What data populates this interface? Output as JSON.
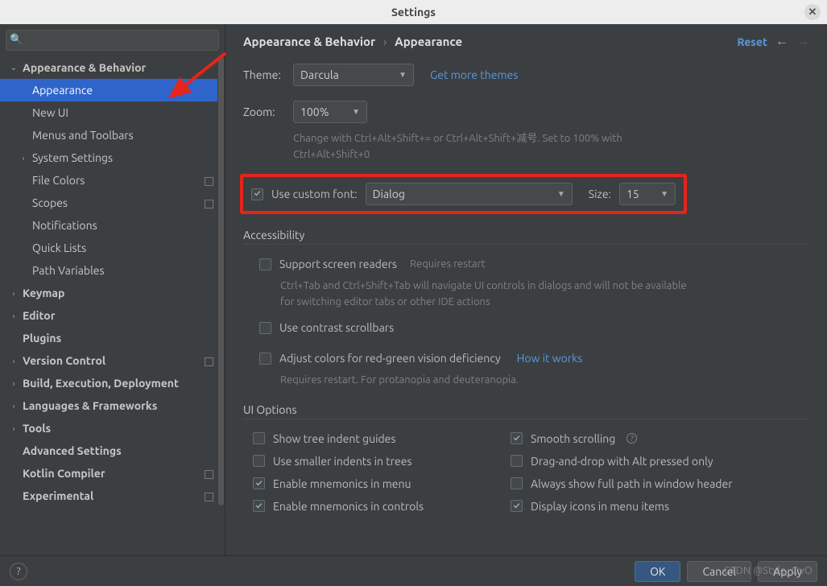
{
  "title": "Settings",
  "search": {
    "placeholder": ""
  },
  "sidebar": [
    {
      "label": "Appearance & Behavior",
      "expanded": true,
      "depth": 0,
      "sel": false,
      "square": false
    },
    {
      "label": "Appearance",
      "depth": 1,
      "sel": true,
      "square": false
    },
    {
      "label": "New UI",
      "depth": 1,
      "sel": false,
      "square": false
    },
    {
      "label": "Menus and Toolbars",
      "depth": 1,
      "sel": false,
      "square": false
    },
    {
      "label": "System Settings",
      "depth": 1,
      "sel": false,
      "square": false,
      "expand": true
    },
    {
      "label": "File Colors",
      "depth": 1,
      "sel": false,
      "square": true
    },
    {
      "label": "Scopes",
      "depth": 1,
      "sel": false,
      "square": true
    },
    {
      "label": "Notifications",
      "depth": 1,
      "sel": false,
      "square": false
    },
    {
      "label": "Quick Lists",
      "depth": 1,
      "sel": false,
      "square": false
    },
    {
      "label": "Path Variables",
      "depth": 1,
      "sel": false,
      "square": false
    },
    {
      "label": "Keymap",
      "depth": 0,
      "sel": false,
      "square": false
    },
    {
      "label": "Editor",
      "depth": 0,
      "sel": false,
      "square": false,
      "expand": true
    },
    {
      "label": "Plugins",
      "depth": 0,
      "sel": false,
      "square": false,
      "noarrow": true
    },
    {
      "label": "Version Control",
      "depth": 0,
      "sel": false,
      "square": true,
      "expand": true
    },
    {
      "label": "Build, Execution, Deployment",
      "depth": 0,
      "sel": false,
      "square": false,
      "expand": true
    },
    {
      "label": "Languages & Frameworks",
      "depth": 0,
      "sel": false,
      "square": false,
      "expand": true
    },
    {
      "label": "Tools",
      "depth": 0,
      "sel": false,
      "square": false,
      "expand": true
    },
    {
      "label": "Advanced Settings",
      "depth": 0,
      "sel": false,
      "square": false,
      "noarrow": true
    },
    {
      "label": "Kotlin Compiler",
      "depth": 0,
      "sel": false,
      "square": true,
      "noarrow": true
    },
    {
      "label": "Experimental",
      "depth": 0,
      "sel": false,
      "square": true,
      "noarrow": true
    }
  ],
  "breadcrumb": {
    "a": "Appearance & Behavior",
    "b": "Appearance",
    "reset": "Reset"
  },
  "theme": {
    "label": "Theme:",
    "value": "Darcula",
    "more": "Get more themes"
  },
  "zoom": {
    "label": "Zoom:",
    "value": "100%",
    "hint": "Change with Ctrl+Alt+Shift+= or Ctrl+Alt+Shift+减号. Set to 100% with Ctrl+Alt+Shift+0"
  },
  "font": {
    "label": "Use custom font:",
    "value": "Dialog",
    "size_label": "Size:",
    "size_value": "15"
  },
  "access": {
    "title": "Accessibility",
    "screen": "Support screen readers",
    "restart": "Requires restart",
    "screen_desc": "Ctrl+Tab and Ctrl+Shift+Tab will navigate UI controls in dialogs and will not be available for switching editor tabs or other IDE actions",
    "contrast": "Use contrast scrollbars",
    "adjust": "Adjust colors for red-green vision deficiency",
    "how": "How it works",
    "adjust_desc": "Requires restart. For protanopia and deuteranopia."
  },
  "uiopt": {
    "title": "UI Options",
    "left": [
      {
        "label": "Show tree indent guides",
        "checked": false
      },
      {
        "label": "Use smaller indents in trees",
        "checked": false
      },
      {
        "label": "Enable mnemonics in menu",
        "checked": true
      },
      {
        "label": "Enable mnemonics in controls",
        "checked": true
      }
    ],
    "right": [
      {
        "label": "Smooth scrolling",
        "checked": true,
        "q": true
      },
      {
        "label": "Drag-and-drop with Alt pressed only",
        "checked": false
      },
      {
        "label": "Always show full path in window header",
        "checked": false
      },
      {
        "label": "Display icons in menu items",
        "checked": true
      }
    ]
  },
  "footer": {
    "ok": "OK",
    "cancel": "Cancel",
    "apply": "Apply"
  },
  "watermark": "CSDN @Style_OvO"
}
